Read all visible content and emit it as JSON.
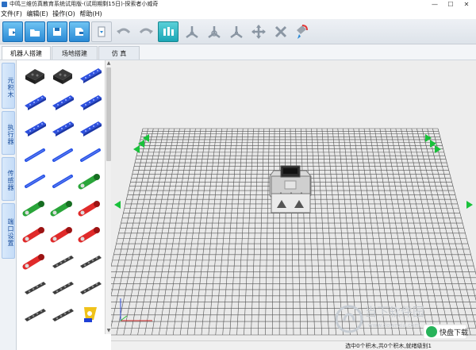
{
  "window": {
    "title": "中鸣三维仿真教育系统试用版-(试用期剩15日)-探索者小威奇",
    "minimize": "—",
    "maximize": "☐",
    "close": "✕"
  },
  "menu": [
    "文件(F)",
    "编辑(E)",
    "操作(O)",
    "帮助(H)"
  ],
  "toolbar": [
    {
      "icon": "new-file-icon"
    },
    {
      "icon": "open-folder-icon"
    },
    {
      "icon": "save-icon"
    },
    {
      "icon": "save-as-icon"
    },
    {
      "icon": "download-icon"
    },
    {
      "icon": "undo-icon"
    },
    {
      "icon": "redo-icon"
    },
    {
      "icon": "assembly-icon"
    },
    {
      "icon": "axis-move-icon"
    },
    {
      "icon": "axis-rotate-icon"
    },
    {
      "icon": "axis-scale-icon"
    },
    {
      "icon": "pan-icon"
    },
    {
      "icon": "delete-part-icon"
    },
    {
      "icon": "paint-icon"
    }
  ],
  "tabs": [
    "机器人搭建",
    "场地搭建",
    "仿 真"
  ],
  "side_tabs": [
    "元积木",
    "执行器",
    "传感器",
    "端口设置"
  ],
  "palette_rows": [
    [
      "dark-block",
      "dark-block",
      "blue-plate"
    ],
    [
      "blue-plate",
      "blue-beam",
      "blue-beam"
    ],
    [
      "blue-beam",
      "blue-beam",
      "blue-beam"
    ],
    [
      "blue-rod",
      "blue-rod",
      "blue-rod"
    ],
    [
      "blue-rod",
      "blue-rod",
      "green-motor"
    ],
    [
      "green-motor",
      "green-motor",
      "red-motor"
    ],
    [
      "red-motor",
      "red-motor",
      "red-motor"
    ],
    [
      "red-motor",
      "gray-beam",
      "gray-beam"
    ],
    [
      "gray-beam",
      "gray-beam",
      "gray-beam"
    ],
    [
      "gray-beam",
      "gray-beam",
      "yellow-part"
    ]
  ],
  "status": "选中0个积木,共0个积木,就绪级别1",
  "watermark": {
    "cn": "当下软件园",
    "en": "www.downxia.com",
    "badge": "快盘下载"
  },
  "colors": {
    "grid": "#555555",
    "floor": "#e9e9e9",
    "accent_green": "#19c13b",
    "toolbar_blue": "#2a8ad6"
  }
}
